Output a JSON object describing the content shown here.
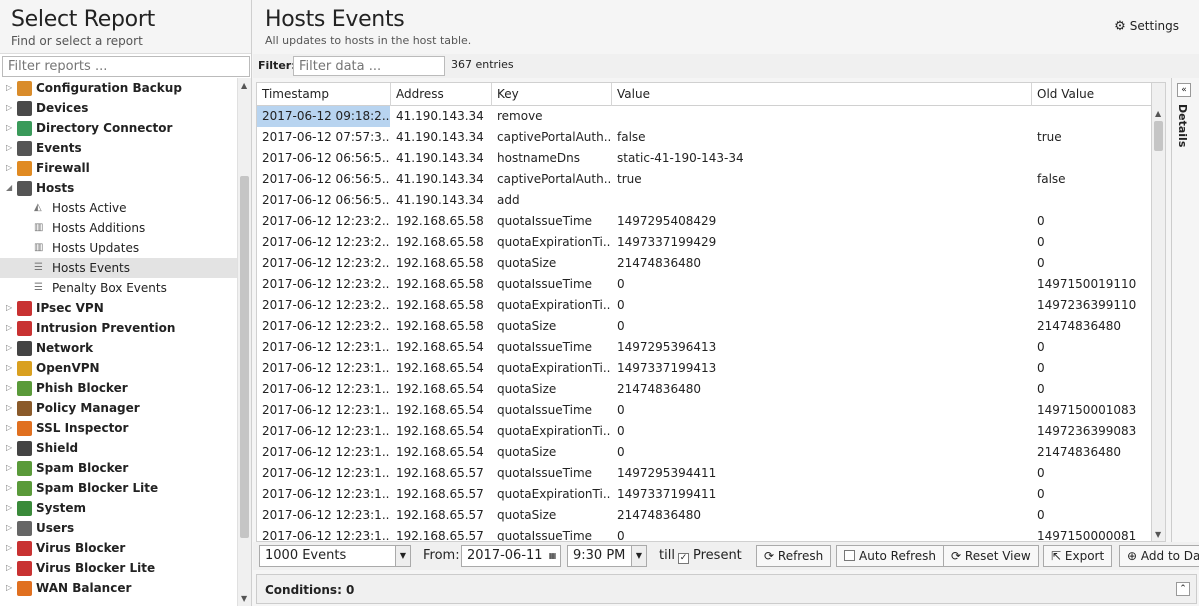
{
  "left": {
    "title": "Select Report",
    "subtitle": "Find or select a report",
    "filter_placeholder": "Filter reports ...",
    "items": [
      {
        "label": "Configuration Backup",
        "level": 1,
        "icon": "configuration-backup-icon",
        "color": "#d98c2b"
      },
      {
        "label": "Devices",
        "level": 1,
        "icon": "devices-icon",
        "color": "#4a4a4a"
      },
      {
        "label": "Directory Connector",
        "level": 1,
        "icon": "directory-connector-icon",
        "color": "#3a9a5a"
      },
      {
        "label": "Events",
        "level": 1,
        "icon": "events-icon",
        "color": "#555555"
      },
      {
        "label": "Firewall",
        "level": 1,
        "icon": "firewall-icon",
        "color": "#e08a22"
      },
      {
        "label": "Hosts",
        "level": 1,
        "icon": "hosts-icon",
        "color": "#555555",
        "expanded": true
      },
      {
        "label": "Hosts Active",
        "level": 2,
        "icon": "area-chart-icon"
      },
      {
        "label": "Hosts Additions",
        "level": 2,
        "icon": "bar-chart-icon"
      },
      {
        "label": "Hosts Updates",
        "level": 2,
        "icon": "bar-chart-icon"
      },
      {
        "label": "Hosts Events",
        "level": 2,
        "icon": "list-icon",
        "selected": true
      },
      {
        "label": "Penalty Box Events",
        "level": 2,
        "icon": "list-icon"
      },
      {
        "label": "IPsec VPN",
        "level": 1,
        "icon": "ipsec-vpn-icon",
        "color": "#c83232"
      },
      {
        "label": "Intrusion Prevention",
        "level": 1,
        "icon": "intrusion-prevention-icon",
        "color": "#c83232"
      },
      {
        "label": "Network",
        "level": 1,
        "icon": "network-icon",
        "color": "#444444"
      },
      {
        "label": "OpenVPN",
        "level": 1,
        "icon": "openvpn-icon",
        "color": "#d9a020"
      },
      {
        "label": "Phish Blocker",
        "level": 1,
        "icon": "phish-blocker-icon",
        "color": "#5a9a3a"
      },
      {
        "label": "Policy Manager",
        "level": 1,
        "icon": "policy-manager-icon",
        "color": "#8a5a2a"
      },
      {
        "label": "SSL Inspector",
        "level": 1,
        "icon": "ssl-inspector-icon",
        "color": "#e07020"
      },
      {
        "label": "Shield",
        "level": 1,
        "icon": "shield-icon",
        "color": "#444444"
      },
      {
        "label": "Spam Blocker",
        "level": 1,
        "icon": "spam-blocker-icon",
        "color": "#5a9a3a"
      },
      {
        "label": "Spam Blocker Lite",
        "level": 1,
        "icon": "spam-blocker-lite-icon",
        "color": "#5a9a3a"
      },
      {
        "label": "System",
        "level": 1,
        "icon": "system-icon",
        "color": "#3a8a3a"
      },
      {
        "label": "Users",
        "level": 1,
        "icon": "users-icon",
        "color": "#666666"
      },
      {
        "label": "Virus Blocker",
        "level": 1,
        "icon": "virus-blocker-icon",
        "color": "#c83232"
      },
      {
        "label": "Virus Blocker Lite",
        "level": 1,
        "icon": "virus-blocker-lite-icon",
        "color": "#c83232"
      },
      {
        "label": "WAN Balancer",
        "level": 1,
        "icon": "wan-balancer-icon",
        "color": "#e07020"
      }
    ]
  },
  "main": {
    "title": "Hosts Events",
    "subtitle": "All updates to hosts in the host table.",
    "settings_label": "Settings",
    "filter_label": "Filter:",
    "filter_placeholder": "Filter data ...",
    "entries": "367 entries",
    "columns": [
      "Timestamp",
      "Address",
      "Key",
      "Value",
      "Old Value"
    ],
    "rows": [
      [
        "2017-06-12 09:18:2...",
        "41.190.143.34",
        "remove",
        "",
        ""
      ],
      [
        "2017-06-12 07:57:3...",
        "41.190.143.34",
        "captivePortalAuth...",
        "false",
        "true"
      ],
      [
        "2017-06-12 06:56:5...",
        "41.190.143.34",
        "hostnameDns",
        "static-41-190-143-34",
        ""
      ],
      [
        "2017-06-12 06:56:5...",
        "41.190.143.34",
        "captivePortalAuth...",
        "true",
        "false"
      ],
      [
        "2017-06-12 06:56:5...",
        "41.190.143.34",
        "add",
        "",
        ""
      ],
      [
        "2017-06-12 12:23:2...",
        "192.168.65.58",
        "quotaIssueTime",
        "1497295408429",
        "0"
      ],
      [
        "2017-06-12 12:23:2...",
        "192.168.65.58",
        "quotaExpirationTi...",
        "1497337199429",
        "0"
      ],
      [
        "2017-06-12 12:23:2...",
        "192.168.65.58",
        "quotaSize",
        "21474836480",
        "0"
      ],
      [
        "2017-06-12 12:23:2...",
        "192.168.65.58",
        "quotaIssueTime",
        "0",
        "1497150019110"
      ],
      [
        "2017-06-12 12:23:2...",
        "192.168.65.58",
        "quotaExpirationTi...",
        "0",
        "1497236399110"
      ],
      [
        "2017-06-12 12:23:2...",
        "192.168.65.58",
        "quotaSize",
        "0",
        "21474836480"
      ],
      [
        "2017-06-12 12:23:1...",
        "192.168.65.54",
        "quotaIssueTime",
        "1497295396413",
        "0"
      ],
      [
        "2017-06-12 12:23:1...",
        "192.168.65.54",
        "quotaExpirationTi...",
        "1497337199413",
        "0"
      ],
      [
        "2017-06-12 12:23:1...",
        "192.168.65.54",
        "quotaSize",
        "21474836480",
        "0"
      ],
      [
        "2017-06-12 12:23:1...",
        "192.168.65.54",
        "quotaIssueTime",
        "0",
        "1497150001083"
      ],
      [
        "2017-06-12 12:23:1...",
        "192.168.65.54",
        "quotaExpirationTi...",
        "0",
        "1497236399083"
      ],
      [
        "2017-06-12 12:23:1...",
        "192.168.65.54",
        "quotaSize",
        "0",
        "21474836480"
      ],
      [
        "2017-06-12 12:23:1...",
        "192.168.65.57",
        "quotaIssueTime",
        "1497295394411",
        "0"
      ],
      [
        "2017-06-12 12:23:1...",
        "192.168.65.57",
        "quotaExpirationTi...",
        "1497337199411",
        "0"
      ],
      [
        "2017-06-12 12:23:1...",
        "192.168.65.57",
        "quotaSize",
        "21474836480",
        "0"
      ],
      [
        "2017-06-12 12:23:1...",
        "192.168.65.57",
        "quotaIssueTime",
        "0",
        "1497150000081"
      ]
    ],
    "details_label": "Details",
    "toolbar": {
      "events_select": "1000 Events",
      "from_label": "From:",
      "from_date": "2017-06-11",
      "from_time": "9:30 PM",
      "till_label": "till",
      "present_label": "Present",
      "refresh_label": "Refresh",
      "auto_refresh_label": "Auto Refresh",
      "reset_view_label": "Reset View",
      "export_label": "Export",
      "add_label": "Add to Da"
    },
    "conditions_label": "Conditions: 0"
  }
}
